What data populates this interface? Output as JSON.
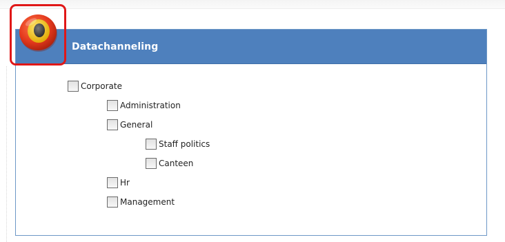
{
  "panel": {
    "title": "Datachanneling"
  },
  "logo": {
    "icon": "target-logo-icon",
    "colors": {
      "outer": "#e4391d",
      "middle": "#f2c313",
      "inner": "#444444",
      "highlight": "#e01717"
    }
  },
  "colors": {
    "header_bg": "#4e80bd",
    "panel_border": "#6c97c6"
  },
  "tree": {
    "nodes": [
      {
        "label": "Corporate",
        "checked": false,
        "level": 0
      },
      {
        "label": "Administration",
        "checked": false,
        "level": 1
      },
      {
        "label": "General",
        "checked": false,
        "level": 1
      },
      {
        "label": "Staff politics",
        "checked": false,
        "level": 2
      },
      {
        "label": "Canteen",
        "checked": false,
        "level": 2
      },
      {
        "label": "Hr",
        "checked": false,
        "level": 1
      },
      {
        "label": "Management",
        "checked": false,
        "level": 1
      }
    ]
  }
}
